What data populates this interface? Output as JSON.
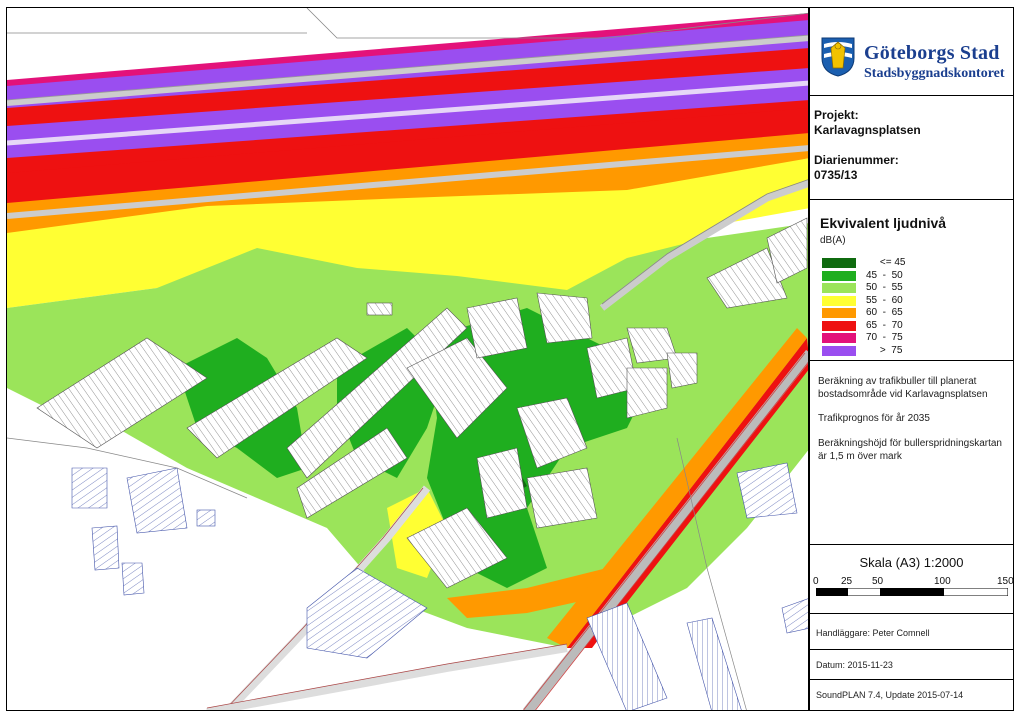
{
  "organization": {
    "name": "Göteborgs Stad",
    "department": "Stadsbyggnadskontoret",
    "logo": "goteborg-crest-icon"
  },
  "project": {
    "label": "Projekt:",
    "value": "Karlavagnsplatsen",
    "diary_label": "Diarienummer:",
    "diary_value": "0735/13"
  },
  "legend": {
    "title": "Ekvivalent ljudnivå",
    "unit": "dB(A)",
    "items": [
      {
        "range": "     <= 45",
        "color": "#0f6b0f"
      },
      {
        "range": "45  -  50",
        "color": "#1fae1f"
      },
      {
        "range": "50  -  55",
        "color": "#9be45a"
      },
      {
        "range": "55  -  60",
        "color": "#ffff33"
      },
      {
        "range": "60  -  65",
        "color": "#ff9900"
      },
      {
        "range": "65  -  70",
        "color": "#ee1111"
      },
      {
        "range": "70  -  75",
        "color": "#e3127a"
      },
      {
        "range": "     >  75",
        "color": "#9a4ef0"
      }
    ]
  },
  "description": {
    "line1": "Beräkning av trafikbuller till planerat",
    "line2": "bostadsområde vid Karlavagnsplatsen",
    "line3": "Trafikprognos för år 2035",
    "line4": "Beräkningshöjd för bullerspridningskartan",
    "line5": "är 1,5 m över mark"
  },
  "scale": {
    "title": "Skala (A3) 1:2000",
    "ticks": [
      "0",
      "25",
      "50",
      "100",
      "150"
    ]
  },
  "footer": {
    "handler": "Handläggare: Peter Comnell",
    "date": "Datum: 2015-11-23",
    "software": "SoundPLAN 7.4, Update 2015-07-14"
  }
}
